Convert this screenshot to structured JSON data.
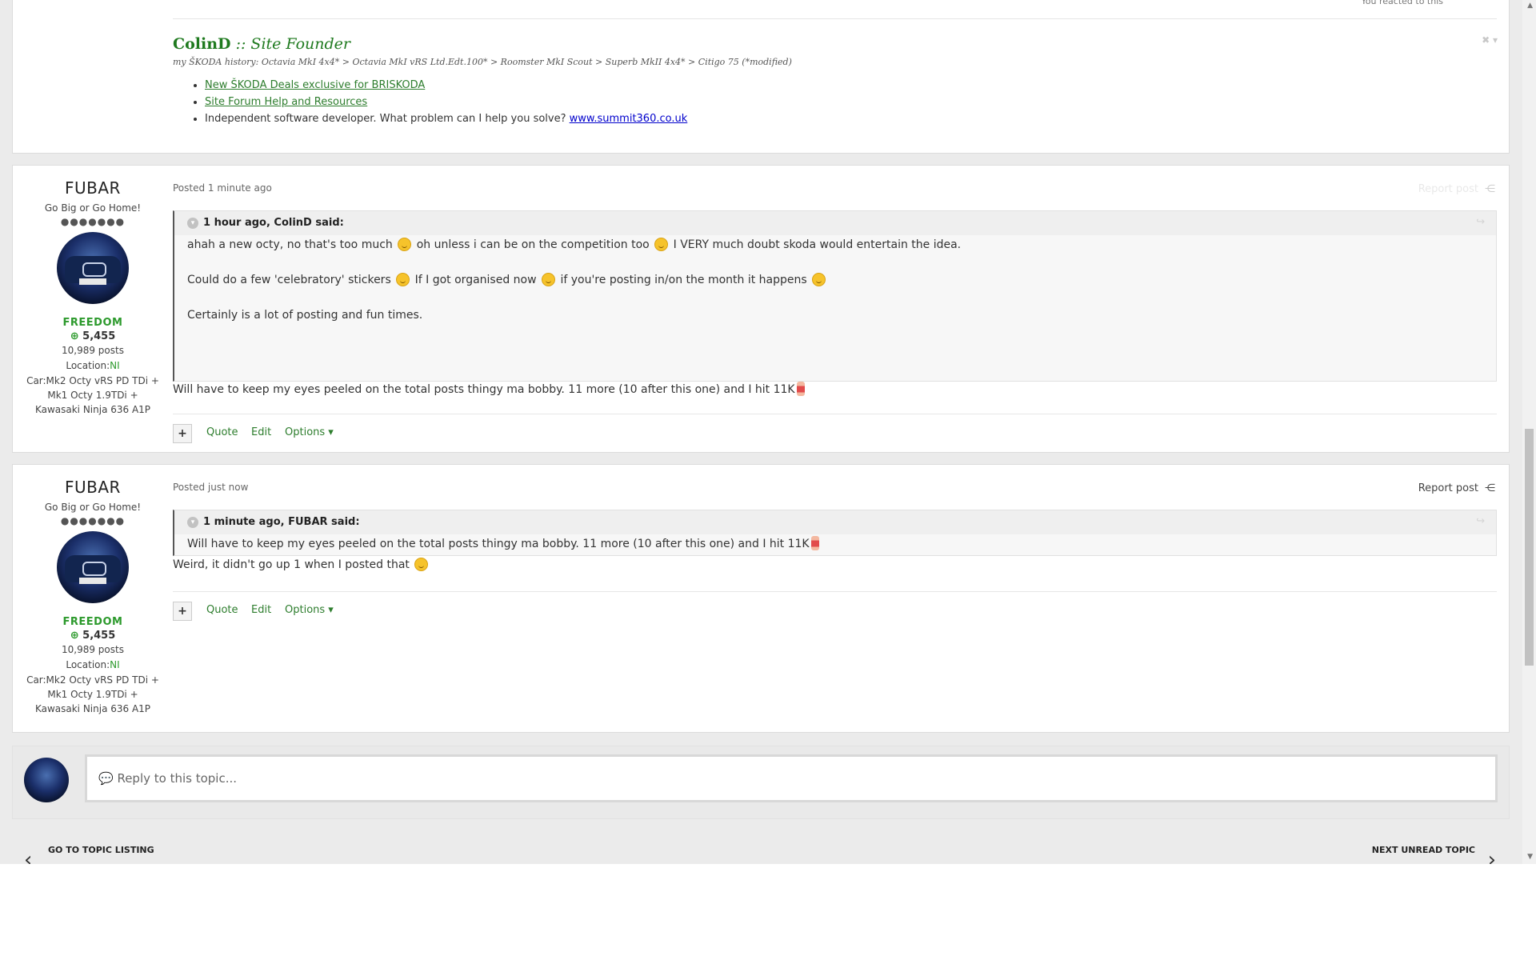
{
  "signature": {
    "reaction_text": "You reacted to this",
    "name": "ColinD",
    "separator": " :: ",
    "role": "Site Founder",
    "history": "my ŠKODA history: Octavia MkI 4x4* > Octavia MkI vRS Ltd.Edt.100* > Roomster MkI Scout > Superb MkII 4x4* > Citigo 75 (*modified)",
    "links": [
      "New ŠKODA Deals exclusive for BRISKODA",
      "Site Forum Help and Resources"
    ],
    "dev_text": "Independent software developer. What problem can I help you solve? ",
    "dev_link": "www.summit360.co.uk"
  },
  "author": {
    "name": "FUBAR",
    "tagline": "Go Big or Go Home!",
    "pips": "●●●●●●●",
    "group": "FREEDOM",
    "reputation": "5,455",
    "posts": "10,989 posts",
    "location_label": "Location:",
    "location_value": "NI",
    "car": "Car:Mk2 Octy vRS PD TDi + Mk1 Octy 1.9TDi + Kawasaki Ninja 636 A1P"
  },
  "post1": {
    "posted": "Posted 1 minute ago",
    "report": "Report post",
    "quote_header": "1 hour ago, ColinD said:",
    "quote_lines": [
      [
        "ahah a new octy, no that's too much",
        "oh unless i can be on the competition too",
        "I VERY much doubt skoda would entertain the idea."
      ],
      [
        "Could do a few 'celebratory' stickers",
        "If I got organised now",
        "if you're posting in/on the month it happens"
      ],
      [
        "Certainly is a lot of posting and fun times."
      ]
    ],
    "body": "Will have to keep my eyes peeled on the total posts thingy ma bobby. 11 more (10 after this one) and I hit 11K"
  },
  "post2": {
    "posted": "Posted just now",
    "report": "Report post",
    "quote_header": "1 minute ago, FUBAR said:",
    "quote_text": "Will have to keep my eyes peeled on the total posts thingy ma bobby. 11 more (10 after this one) and I hit 11K",
    "body": "Weird, it didn't go up 1 when I posted that"
  },
  "controls": {
    "plus": "+",
    "quote": "Quote",
    "edit": "Edit",
    "options": "Options ▾"
  },
  "reply": {
    "placeholder": "💬 Reply to this topic..."
  },
  "nav": {
    "prev_label": "GO TO TOPIC LISTING",
    "next_label": "NEXT UNREAD TOPIC"
  }
}
